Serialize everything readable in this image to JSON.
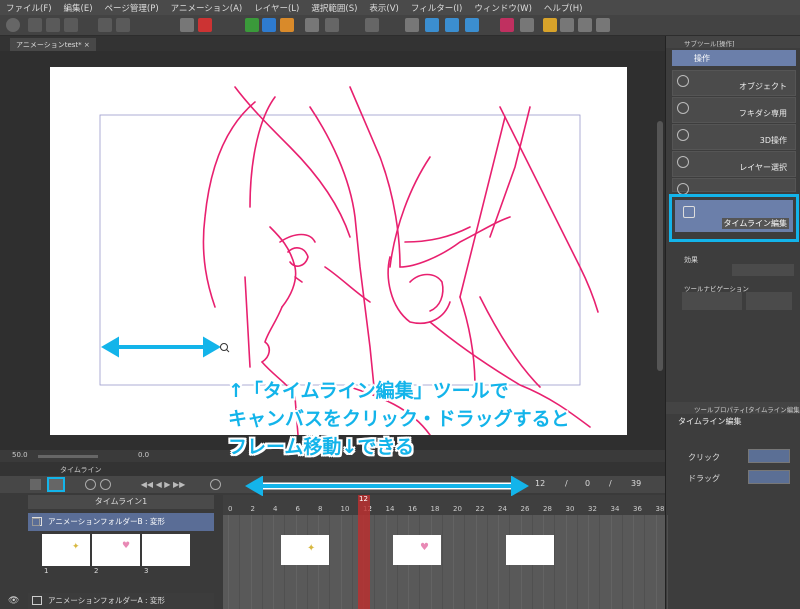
{
  "menu": [
    "ファイル(F)",
    "編集(E)",
    "ページ管理(P)",
    "アニメーション(A)",
    "レイヤー(L)",
    "選択範囲(S)",
    "表示(V)",
    "フィルター(I)",
    "ウィンドウ(W)",
    "ヘルプ(H)"
  ],
  "document_tab": "アニメーションtest*",
  "status": {
    "zoom": "50.0",
    "angle": "0.0"
  },
  "subtool": {
    "header": "サブツール[操作]",
    "title": "操作",
    "items": [
      "オブジェクト",
      "フキダシ専用",
      "3D操作",
      "レイヤー選択",
      "タイムライン編集"
    ],
    "effects_label": "効果",
    "nav_label": "ツールナビゲーション"
  },
  "toolprop": {
    "header": "ツールプロパティ[タイムライン編集]",
    "title": "タイムライン編集",
    "click_label": "クリック",
    "drag_label": "ドラッグ"
  },
  "timeline": {
    "tab": "タイムライン",
    "name": "タイムライン1",
    "current_frame": "12",
    "counter": [
      "12",
      "/",
      "0",
      "/",
      "39"
    ],
    "ticks": [
      "0",
      "2",
      "4",
      "6",
      "8",
      "10",
      "12",
      "14",
      "16",
      "18",
      "20",
      "22",
      "24",
      "26",
      "28",
      "30",
      "32",
      "34",
      "36",
      "38"
    ],
    "layers": [
      "アニメーションフォルダーB : 変形",
      "アニメーションフォルダーA : 変形"
    ],
    "thumb_labels": [
      "1",
      "2",
      "3"
    ]
  },
  "annotation": {
    "line1": "↑「タイムライン編集」ツールで",
    "line2": "キャンバスをクリック・ドラッグすると",
    "line3": "フレーム移動↓できる"
  },
  "colors": {
    "highlight": "#13b4ea",
    "lineart": "#e8206f",
    "playhead": "#c03030"
  }
}
